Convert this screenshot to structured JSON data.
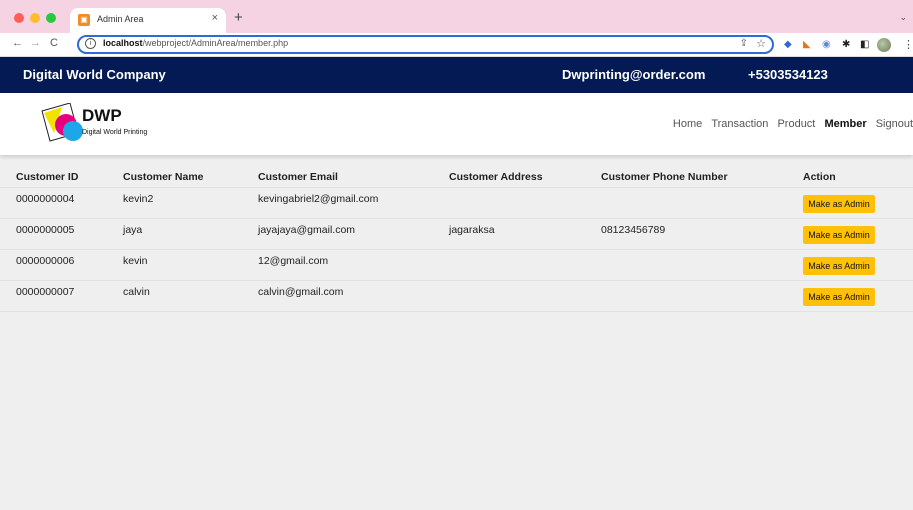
{
  "browser": {
    "tab_title": "Admin Area",
    "tab_favicon": "html-icon",
    "url_host": "localhost",
    "url_path": "/webproject/AdminArea/member.php"
  },
  "topbar": {
    "company": "Digital World Company",
    "email": "Dwprinting@order.com",
    "phone": "+5303534123"
  },
  "logo": {
    "name": "DWP",
    "tagline": "Digital World Printing"
  },
  "nav": {
    "items": [
      "Home",
      "Transaction",
      "Product",
      "Member",
      "Signout"
    ],
    "active": "Member"
  },
  "table": {
    "headers": [
      "Customer ID",
      "Customer Name",
      "Customer Email",
      "Customer Address",
      "Customer Phone Number",
      "Action"
    ],
    "rows": [
      {
        "id": "0000000004",
        "name": "kevin2",
        "email": "kevingabriel2@gmail.com",
        "address": "",
        "phone": "",
        "action": "Make as Admin"
      },
      {
        "id": "0000000005",
        "name": "jaya",
        "email": "jayajaya@gmail.com",
        "address": "jagaraksa",
        "phone": "08123456789",
        "action": "Make as Admin"
      },
      {
        "id": "0000000006",
        "name": "kevin",
        "email": "12@gmail.com",
        "address": "",
        "phone": "",
        "action": "Make as Admin"
      },
      {
        "id": "0000000007",
        "name": "calvin",
        "email": "calvin@gmail.com",
        "address": "",
        "phone": "",
        "action": "Make as Admin"
      }
    ]
  },
  "colors": {
    "topbar_bg": "#041a54",
    "button_bg": "#ffc107",
    "tabbar_bg": "#f6d3e2"
  }
}
